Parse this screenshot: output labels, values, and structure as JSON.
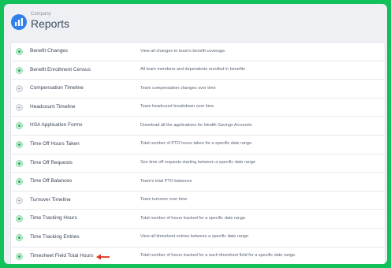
{
  "header": {
    "company": "Company",
    "title": "Reports",
    "logo_icon": "bar-chart-icon"
  },
  "colors": {
    "background_green": "#12c15a",
    "logo_blue": "#2f80ed",
    "arrow_red": "#e0331f"
  },
  "reports": [
    {
      "name": "Benefit Changes",
      "description": "View all changes to team's benefit coverage.",
      "status": "ok"
    },
    {
      "name": "Benefit Enrollment Census",
      "description": "All team members and dependents enrolled in benefits",
      "status": "ok"
    },
    {
      "name": "Compensation Timeline",
      "description": "Team compensation changes over time",
      "status": "muted"
    },
    {
      "name": "Headcount Timeline",
      "description": "Team headcount breakdown over time",
      "status": "muted"
    },
    {
      "name": "HSA Application Forms",
      "description": "Download all the applications for Health Savings Accounts",
      "status": "ok"
    },
    {
      "name": "Time Off Hours Taken",
      "description": "Total number of PTO hours taken for a specific date range",
      "status": "ok"
    },
    {
      "name": "Time Off Requests",
      "description": "See time off requests starting between a specific date range",
      "status": "ok"
    },
    {
      "name": "Time Off Balances",
      "description": "Team's total PTO balances",
      "status": "ok"
    },
    {
      "name": "Turnover Timeline",
      "description": "Team turnover over time",
      "status": "muted"
    },
    {
      "name": "Time Tracking Hours",
      "description": "Total number of hours tracked for a specific date range.",
      "status": "ok"
    },
    {
      "name": "Time Tracking Entries",
      "description": "View all timesheet entries between a specific date range.",
      "status": "ok"
    },
    {
      "name": "Timesheet Field Total Hours",
      "description": "Total number of hours tracked for a each timesheet field for a specific date range.",
      "status": "ok",
      "annotation": "red-arrow-icon"
    }
  ]
}
